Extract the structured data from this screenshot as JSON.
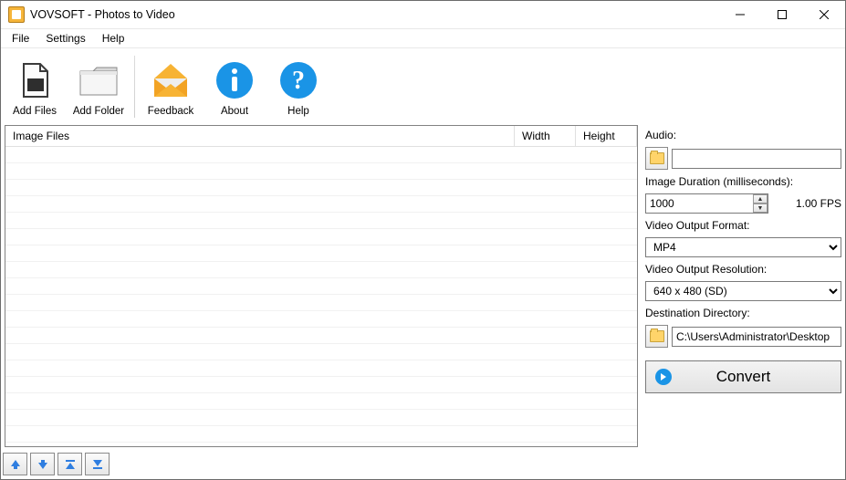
{
  "titlebar": {
    "title": "VOVSOFT - Photos to Video"
  },
  "menubar": {
    "items": [
      "File",
      "Settings",
      "Help"
    ]
  },
  "toolbar": {
    "add_files": "Add Files",
    "add_folder": "Add Folder",
    "feedback": "Feedback",
    "about": "About",
    "help": "Help"
  },
  "list": {
    "col_files": "Image Files",
    "col_width": "Width",
    "col_height": "Height"
  },
  "side": {
    "audio_lbl": "Audio:",
    "audio_value": "",
    "duration_lbl": "Image Duration (milliseconds):",
    "duration_value": "1000",
    "fps": "1.00 FPS",
    "format_lbl": "Video Output Format:",
    "format_value": "MP4",
    "res_lbl": "Video Output Resolution:",
    "res_value": "640 x 480 (SD)",
    "dest_lbl": "Destination Directory:",
    "dest_value": "C:\\Users\\Administrator\\Desktop",
    "convert_lbl": "Convert"
  }
}
